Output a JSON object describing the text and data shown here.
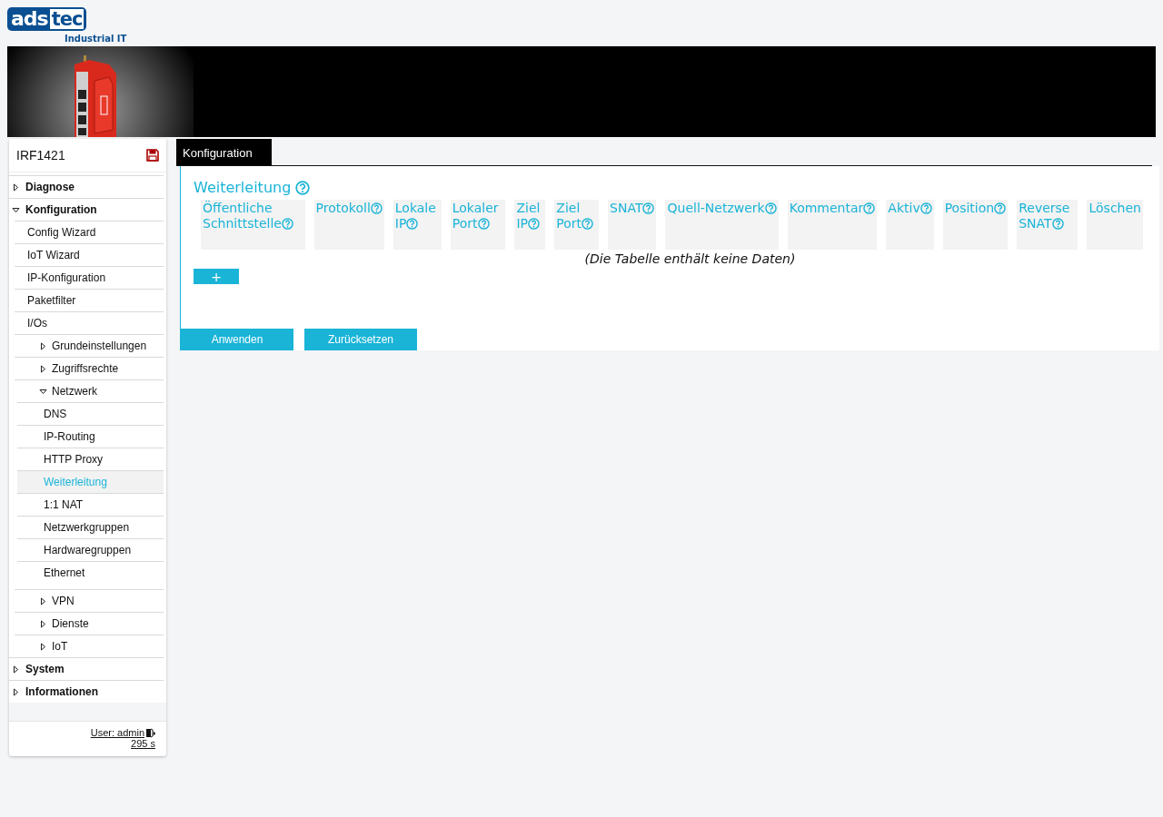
{
  "logo": {
    "part_1": "ads",
    "part_2": "tec",
    "tagline": "Industrial IT"
  },
  "sidebar": {
    "device": "IRF1421",
    "items": [
      {
        "label": "Diagnose",
        "kind": "section",
        "expanded": false
      },
      {
        "label": "Konfiguration",
        "kind": "section",
        "expanded": true,
        "children": [
          {
            "label": "Config Wizard",
            "kind": "leaf",
            "selected": false
          },
          {
            "label": "IoT Wizard",
            "kind": "leaf",
            "selected": false
          },
          {
            "label": "IP-Konfiguration",
            "kind": "leaf",
            "selected": false
          },
          {
            "label": "Paketfilter",
            "kind": "leaf",
            "selected": false
          },
          {
            "label": "I/Os",
            "kind": "leaf",
            "selected": false
          },
          {
            "label": "Grundeinstellungen",
            "kind": "group",
            "expanded": false
          },
          {
            "label": "Zugriffsrechte",
            "kind": "group",
            "expanded": false
          },
          {
            "label": "Netzwerk",
            "kind": "group",
            "expanded": true,
            "children": [
              {
                "label": "DNS",
                "kind": "leaf",
                "selected": false
              },
              {
                "label": "IP-Routing",
                "kind": "leaf",
                "selected": false
              },
              {
                "label": "HTTP Proxy",
                "kind": "leaf",
                "selected": false
              },
              {
                "label": "Weiterleitung",
                "kind": "leaf",
                "selected": true
              },
              {
                "label": "1:1 NAT",
                "kind": "leaf",
                "selected": false
              },
              {
                "label": "Netzwerkgruppen",
                "kind": "leaf",
                "selected": false
              },
              {
                "label": "Hardwaregruppen",
                "kind": "leaf",
                "selected": false
              },
              {
                "label": "Ethernet",
                "kind": "leaf",
                "selected": false
              }
            ]
          },
          {
            "label": "VPN",
            "kind": "group",
            "expanded": false
          },
          {
            "label": "Dienste",
            "kind": "group",
            "expanded": false
          },
          {
            "label": "IoT",
            "kind": "group",
            "expanded": false
          }
        ]
      },
      {
        "label": "System",
        "kind": "section",
        "expanded": false
      },
      {
        "label": "Informationen",
        "kind": "section",
        "expanded": false
      }
    ],
    "user": "User: admin",
    "timer": "295 s"
  },
  "tabs": [
    {
      "label": "Konfiguration",
      "selected": true
    }
  ],
  "section": {
    "title": "Weiterleitung",
    "columns": [
      {
        "label": "Öffentliche Schnittstelle",
        "help": true
      },
      {
        "label": "Protokoll",
        "help": true
      },
      {
        "label": "Lokale IP",
        "help": true
      },
      {
        "label": "Lokaler Port",
        "help": true
      },
      {
        "label": "Ziel IP",
        "help": true
      },
      {
        "label": "Ziel Port",
        "help": true
      },
      {
        "label": "SNAT",
        "help": true
      },
      {
        "label": "Quell-Netzwerk",
        "help": true
      },
      {
        "label": "Kommentar",
        "help": true
      },
      {
        "label": "Aktiv",
        "help": true
      },
      {
        "label": "Position",
        "help": true
      },
      {
        "label": "Reverse SNAT",
        "help": true
      },
      {
        "label": "Löschen",
        "help": false
      }
    ],
    "empty_text": "(Die Tabelle enthält keine Daten)",
    "add_button": "+"
  },
  "buttons": [
    "Anwenden",
    "Zurücksetzen"
  ]
}
